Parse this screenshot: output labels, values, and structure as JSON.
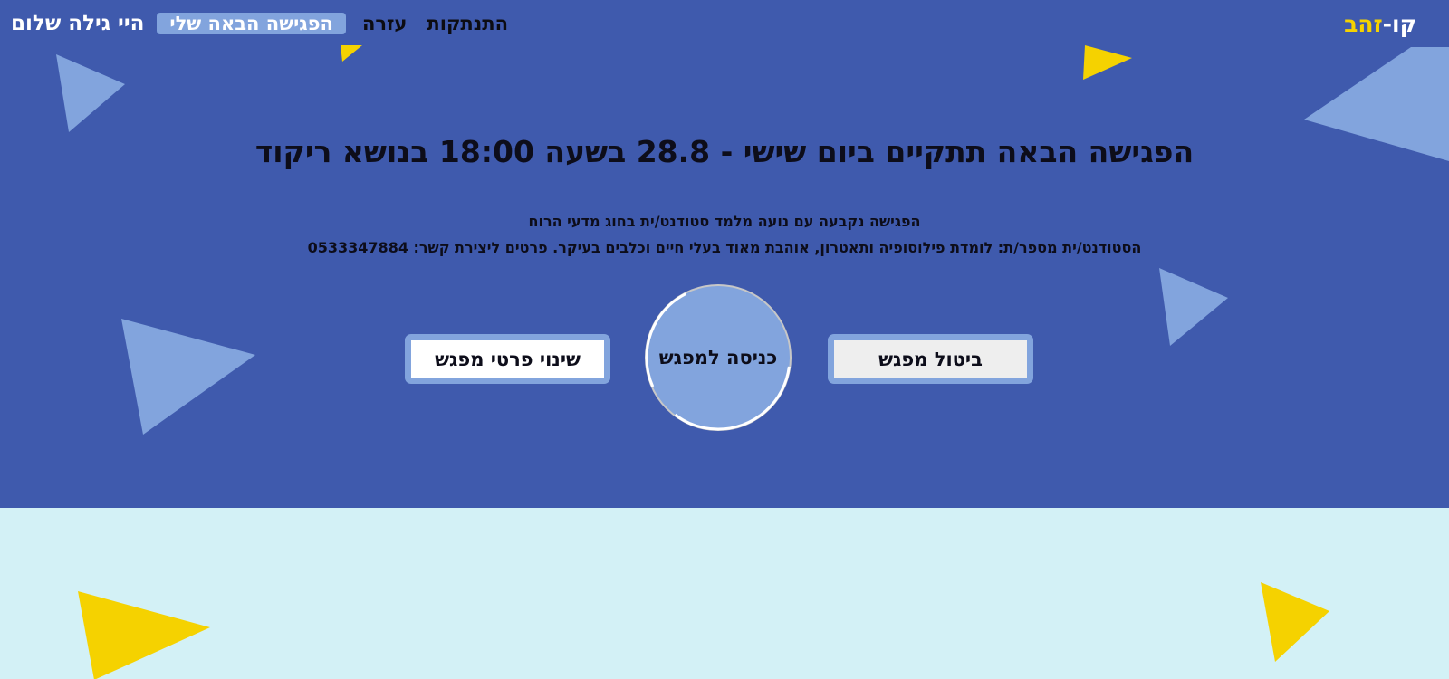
{
  "brand": {
    "logo_part_1": "קו",
    "logo_separator": "-",
    "logo_part_2": "זהב"
  },
  "nav": {
    "greeting": "היי גילה שלום",
    "items": [
      {
        "label": "הפגישה הבאה שלי",
        "active": true
      },
      {
        "label": "עזרה",
        "active": false
      },
      {
        "label": "התנתקות",
        "active": false
      }
    ]
  },
  "main": {
    "headline": "הפגישה הבאה תתקיים ביום שישי - 28.8 בשעה 18:00 בנושא ריקוד",
    "details_line1": "הפגישה נקבעה עם נועה מלמד סטודנט/ית בחוג מדעי הרוח",
    "details_line2": "הסטודנט/ית מספר/ת: לומדת פילוסופיה ותאטרון, אוהבת מאוד בעלי חיים וכלבים בעיקר. פרטים ליצירת קשר: 0533347884"
  },
  "buttons": {
    "cancel": "ביטול מפגש",
    "enter": "כניסה למפגש",
    "change": "שינוי פרטי מפגש"
  },
  "colors": {
    "top_background": "#3f5aad",
    "bottom_background": "#d3f1f6",
    "accent_light_blue": "#82a4dd",
    "accent_yellow": "#f5d200"
  }
}
